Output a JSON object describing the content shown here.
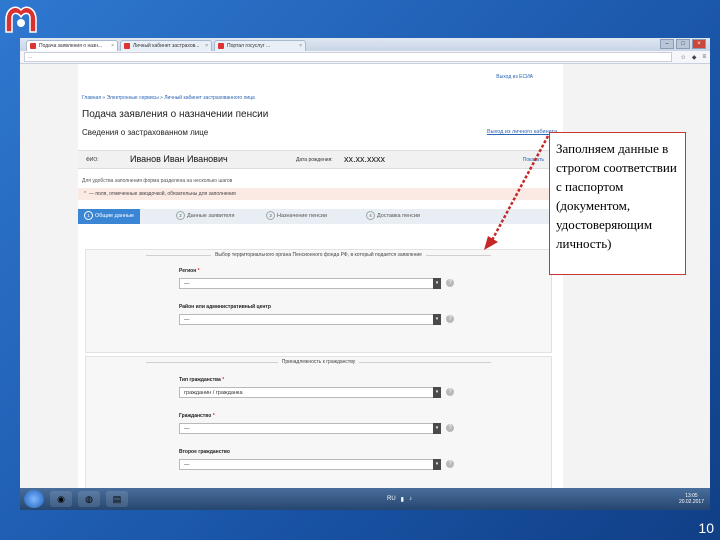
{
  "browser": {
    "tabs": [
      {
        "label": "Подача заявления о назн...",
        "active": true
      },
      {
        "label": "Личный кабинет застрахов...",
        "active": false
      },
      {
        "label": "Портал госуслуг ...",
        "active": false
      }
    ],
    "address": "...",
    "gos_login": "Выход из ЕСИА"
  },
  "page": {
    "breadcrumb": "Главная » Электронные сервисы » Личный кабинет застрахованного лица",
    "title": "Подача заявления о назначении пенсии",
    "subhead": "Сведения о застрахованном лице",
    "exit_link": "Выход из личного кабинета",
    "person": {
      "fio_label": "ФИО:",
      "fio_value": "Иванов Иван Иванович",
      "dob_label": "Дата рождения:",
      "dob_value": "хх.хх.хххх",
      "edit": "Показать"
    },
    "hint": "Для удобства заполнения форма разделена на несколько шагов",
    "required_note": "— поля, отмеченные звездочкой, обязательны для заполнения",
    "steps": [
      {
        "num": "1",
        "label": "Общие данные",
        "active": true
      },
      {
        "num": "2",
        "label": "Данные заявителя",
        "active": false
      },
      {
        "num": "3",
        "label": "Назначение пенсии",
        "active": false
      },
      {
        "num": "4",
        "label": "Доставка пенсии",
        "active": false
      }
    ],
    "section1": {
      "legend": "Выбор территориального органа Пенсионного фонда РФ, в который подается заявление",
      "region_label": "Регион",
      "region_value": "—",
      "district_label": "Район или административный центр",
      "district_value": "—"
    },
    "section2": {
      "legend": "Принадлежность к гражданству",
      "type_label": "Тип гражданства",
      "type_value": "гражданин / гражданка",
      "citizenship_label": "Гражданство",
      "citizenship_value": "—",
      "other_label": "Второе гражданство",
      "other_value": "—"
    }
  },
  "taskbar": {
    "lang": "RU",
    "time": "13:05",
    "date": "20.02.2017"
  },
  "callout": {
    "text": "Заполняем данные в строгом соответствии с паспортом (документом, удостоверяющим личность)"
  },
  "slide_number": "10",
  "colors": {
    "accent": "#3b86d4",
    "callout_border": "#cc3333"
  }
}
